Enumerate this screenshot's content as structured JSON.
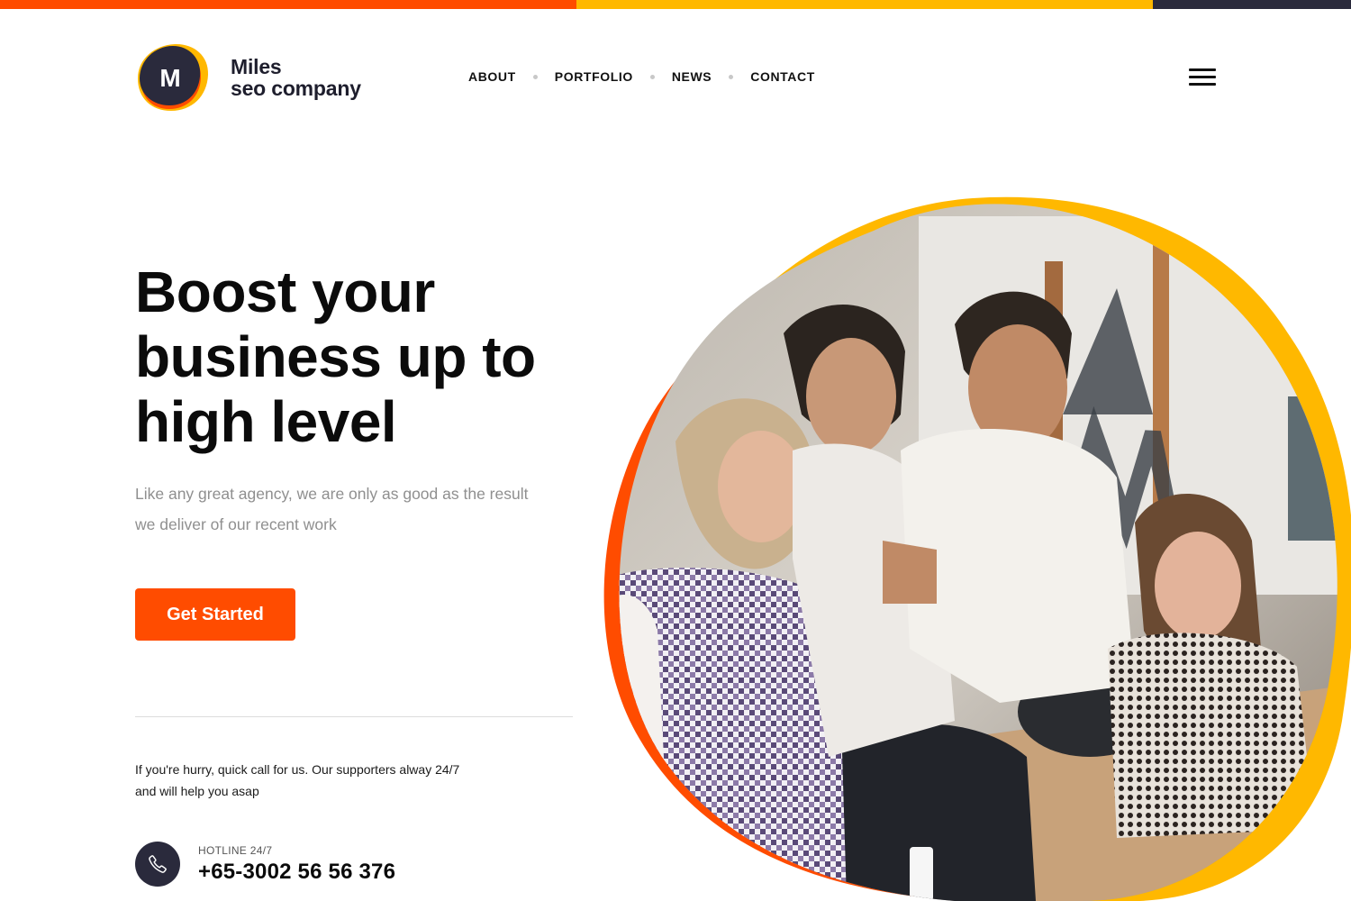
{
  "colors": {
    "accent_orange": "#ff4c00",
    "accent_yellow": "#ffb800",
    "navy": "#2a2a3c",
    "topbar": [
      "#ff4c00",
      "#ffb800",
      "#2a2a3c"
    ]
  },
  "header": {
    "logo": {
      "mark_letter": "M",
      "line1": "Miles",
      "line2": "seo company"
    },
    "nav": [
      "ABOUT",
      "PORTFOLIO",
      "NEWS",
      "CONTACT"
    ],
    "menu_icon": "hamburger-icon"
  },
  "hero": {
    "title_lines": [
      "Boost your",
      "business up to",
      "high level"
    ],
    "subtitle_lines": [
      "Like any great agency, we are only as good as the result",
      "we deliver of our recent work"
    ],
    "cta_label": "Get Started",
    "note_lines": [
      "If you're hurry, quick call for us. Our supporters alway 24/7",
      "and will help you asap"
    ],
    "hotline_label": "HOTLINE 24/7",
    "hotline_number": "+65-3002 56 56 376",
    "phone_icon": "phone-icon",
    "image": "team-meeting-photo"
  }
}
